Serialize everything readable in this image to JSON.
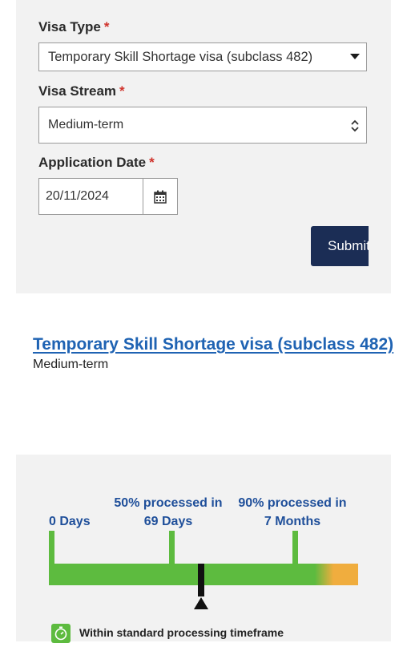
{
  "form": {
    "visa_type": {
      "label": "Visa Type",
      "required": "*",
      "value": "Temporary Skill Shortage visa (subclass 482)"
    },
    "visa_stream": {
      "label": "Visa Stream",
      "required": "*",
      "value": "Medium-term"
    },
    "application_date": {
      "label": "Application Date",
      "required": "*",
      "value": "20/11/2024"
    },
    "submit_label": "Submit"
  },
  "result": {
    "title": "Temporary Skill Shortage visa (subclass 482)",
    "stream": "Medium-term"
  },
  "timeline": {
    "start_label": "0 Days",
    "p50_line1": "50% processed in",
    "p50_line2": "69 Days",
    "p90_line1": "90% processed in",
    "p90_line2": "7 Months",
    "legend": "Within standard processing timeframe",
    "colors": {
      "within": "#5dbb3f",
      "over": "#f0ad3e",
      "marker": "#111111",
      "label": "#1f4f9a"
    }
  },
  "icons": [
    "caret-down-icon",
    "select-updown-icon",
    "calendar-icon",
    "timer-icon",
    "marker-arrow-icon"
  ]
}
